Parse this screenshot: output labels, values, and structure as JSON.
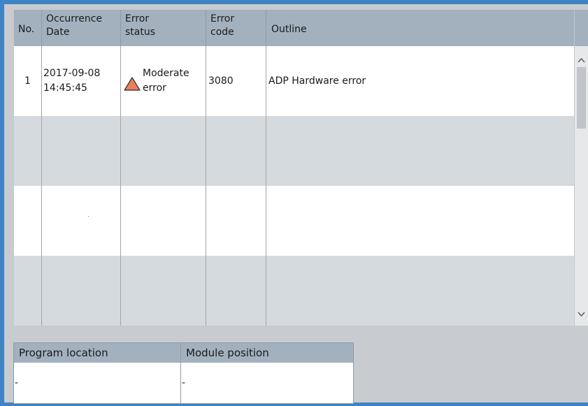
{
  "error_table": {
    "columns": [
      {
        "key": "no",
        "label": "No."
      },
      {
        "key": "date",
        "label": "Occurrence Date"
      },
      {
        "key": "status",
        "label": "Error status"
      },
      {
        "key": "code",
        "label": "Error code"
      },
      {
        "key": "outline",
        "label": "Outline"
      }
    ],
    "header": {
      "no": "No.",
      "date_line1": "Occurrence",
      "date_line2": "Date",
      "status_line1": "Error",
      "status_line2": "status",
      "code_line1": "Error",
      "code_line2": "code",
      "outline": "Outline"
    },
    "rows": [
      {
        "no": "1",
        "date_line1": "2017-09-08",
        "date_line2": "14:45:45",
        "status_icon": "warning-triangle-icon",
        "status_line1": "Moderate",
        "status_line2": "error",
        "code": "3080",
        "outline": "ADP Hardware error"
      },
      {
        "no": "",
        "date_line1": "",
        "date_line2": "",
        "status_icon": "",
        "status_line1": "",
        "status_line2": "",
        "code": "",
        "outline": ""
      },
      {
        "no": "",
        "date_line1": "",
        "date_line2": "",
        "status_icon": "",
        "status_line1": "",
        "status_line2": "",
        "code": "",
        "outline": ""
      },
      {
        "no": "",
        "date_line1": "",
        "date_line2": "",
        "status_icon": "",
        "status_line1": "",
        "status_line2": "",
        "code": "",
        "outline": ""
      }
    ]
  },
  "scrollbar": {
    "up_icon": "chevron-up-icon",
    "down_icon": "chevron-down-icon"
  },
  "detail_table": {
    "headers": {
      "program_location": "Program location",
      "module_position": "Module position"
    },
    "values": {
      "program_location": "-",
      "module_position": "-"
    }
  },
  "colors": {
    "frame_border": "#3f83c4",
    "header_bg": "#a3b1bf",
    "row_alt_bg": "#d5dadf",
    "panel_bg": "#c8cbcf",
    "warning_fill": "#e8825a"
  }
}
